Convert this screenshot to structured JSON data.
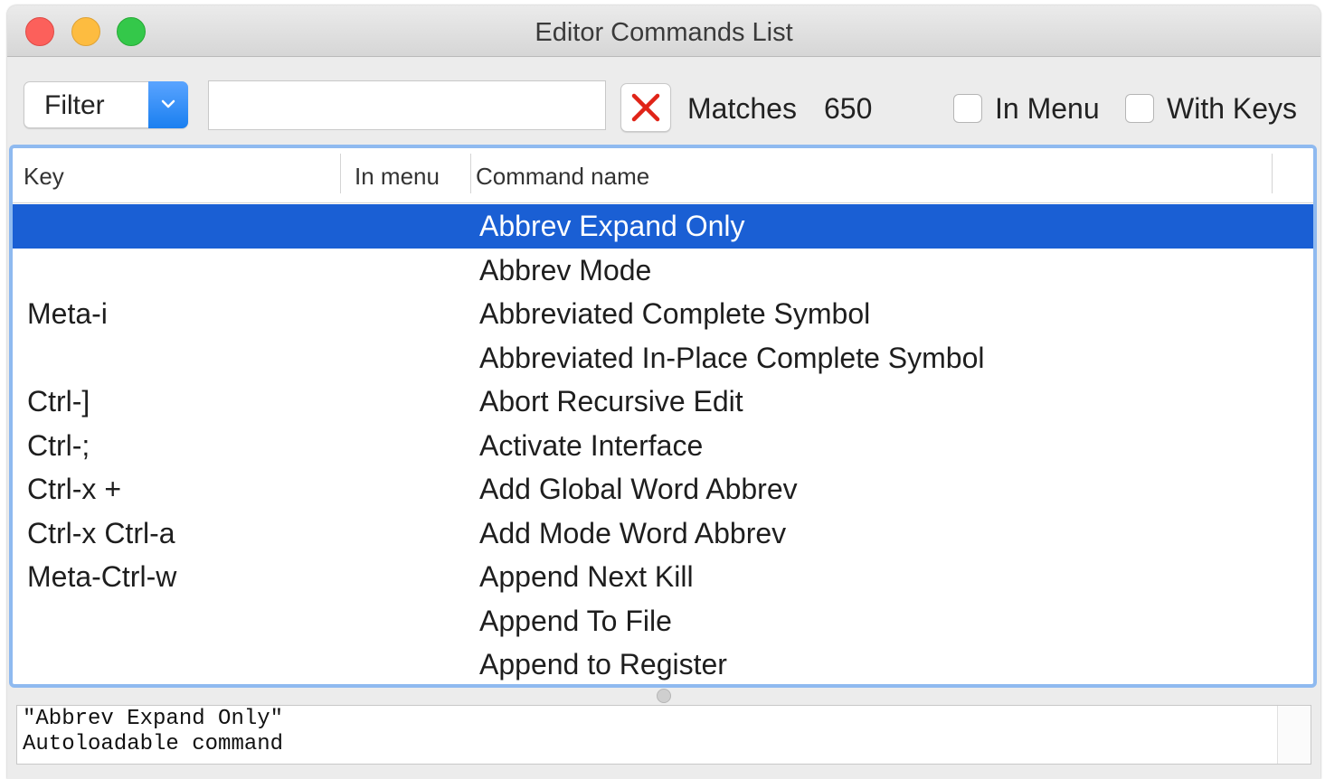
{
  "window": {
    "title": "Editor Commands List"
  },
  "toolbar": {
    "filter_select": {
      "selected": "Filter"
    },
    "filter_input": {
      "value": ""
    },
    "matches_label": "Matches",
    "matches_count": "650",
    "in_menu": {
      "label": "In Menu",
      "checked": false
    },
    "with_keys": {
      "label": "With Keys",
      "checked": false
    }
  },
  "table": {
    "columns": {
      "key": "Key",
      "menu": "In menu",
      "command": "Command name"
    },
    "rows": [
      {
        "key": "",
        "menu": "",
        "command": "Abbrev Expand Only",
        "selected": true
      },
      {
        "key": "",
        "menu": "",
        "command": "Abbrev Mode"
      },
      {
        "key": "Meta-i",
        "menu": "",
        "command": "Abbreviated Complete Symbol"
      },
      {
        "key": "",
        "menu": "",
        "command": "Abbreviated In-Place Complete Symbol"
      },
      {
        "key": "Ctrl-]",
        "menu": "",
        "command": "Abort Recursive Edit"
      },
      {
        "key": "Ctrl-;",
        "menu": "",
        "command": "Activate Interface"
      },
      {
        "key": "Ctrl-x +",
        "menu": "",
        "command": "Add Global Word Abbrev"
      },
      {
        "key": "Ctrl-x Ctrl-a",
        "menu": "",
        "command": "Add Mode Word Abbrev"
      },
      {
        "key": "Meta-Ctrl-w",
        "menu": "",
        "command": "Append Next Kill"
      },
      {
        "key": "",
        "menu": "",
        "command": "Append To File"
      },
      {
        "key": "",
        "menu": "",
        "command": "Append to Register"
      }
    ]
  },
  "info": {
    "line1": "\"Abbrev Expand Only\"",
    "line2": "Autoloadable command"
  },
  "colors": {
    "selection": "#1a5fd4",
    "accent": "#1a7ff0",
    "focus_ring": "#8fbaf0",
    "clear_x": "#e02418"
  }
}
